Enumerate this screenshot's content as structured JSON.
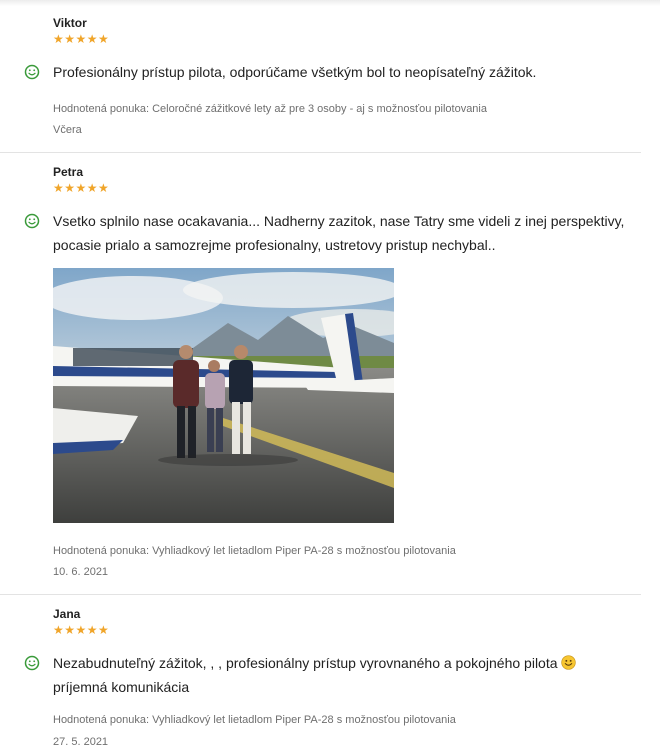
{
  "reviews": [
    {
      "author": "Viktor",
      "stars": "★★★★★",
      "text": "Profesionálny prístup pilota, odporúčame všetkým bol to neopísateľný zážitok.",
      "offer": "Hodnotená ponuka: Celoročné zážitkové lety až pre 3 osoby - aj s možnosťou pilotovania",
      "date": "Včera"
    },
    {
      "author": "Petra",
      "stars": "★★★★★",
      "text": "Vsetko splnilo nase ocakavania... Nadherny zazitok, nase Tatry sme videli z inej perspektivy, pocasie prialo a samozrejme profesionalny, ustretovy pristup nechybal..",
      "offer": "Hodnotená ponuka: Vyhliadkový let lietadlom Piper PA-28 s možnosťou pilotovania",
      "date": "10. 6. 2021"
    },
    {
      "author": "Jana",
      "stars": "★★★★★",
      "text_before": "Nezabudnuteľný zážitok, , , profesionálny prístup vyrovnaného a pokojného pilota",
      "text_after": "príjemná komunikácia",
      "offer": "Hodnotená ponuka: Vyhliadkový let lietadlom Piper PA-28 s možnosťou pilotovania",
      "date": "27. 5. 2021"
    }
  ],
  "icons": {
    "sentiment": "positive-smiley-icon",
    "inline": "smiley-emoji-icon"
  },
  "colors": {
    "star": "#f0a52a",
    "smiley": "#3a9a3a",
    "muted_text": "#6f6f6f"
  }
}
